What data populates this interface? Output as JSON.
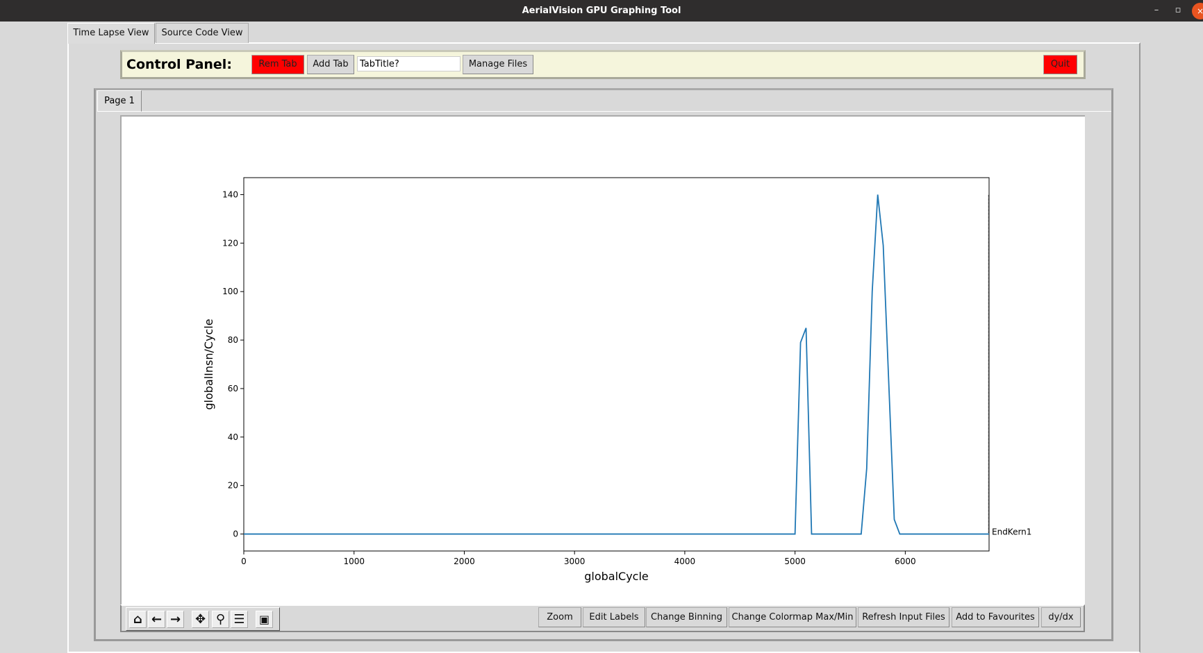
{
  "window": {
    "title": "AerialVision GPU Graphing Tool",
    "minimize": "–",
    "maximize": "▫",
    "close": "×"
  },
  "tabs": [
    {
      "label": "Time Lapse View",
      "active": true
    },
    {
      "label": "Source Code View",
      "active": false
    }
  ],
  "control_panel": {
    "title": "Control Panel:",
    "rem_tab": "Rem Tab",
    "add_tab": "Add Tab",
    "tab_title_value": "TabTitle?",
    "manage_files": "Manage Files",
    "quit": "Quit",
    "danger_color": "#ff0000"
  },
  "page_tabs": [
    {
      "label": "Page 1"
    }
  ],
  "toolbar": {
    "icons": [
      "home-icon",
      "back-arrow-icon",
      "forward-arrow-icon",
      "pan-icon",
      "zoom-magnifier-icon",
      "configure-subplots-icon",
      "save-icon"
    ],
    "buttons": [
      "Zoom",
      "Edit Labels",
      "Change Binning",
      "Change Colormap Max/Min",
      "Refresh Input Files",
      "Add to Favourites",
      "dy/dx"
    ]
  },
  "chart_data": {
    "type": "line",
    "xlabel": "globalCycle",
    "ylabel": "globalInsn/Cycle",
    "xlim": [
      0,
      6760
    ],
    "ylim": [
      -7,
      147
    ],
    "xticks": [
      0,
      1000,
      2000,
      3000,
      4000,
      5000,
      6000
    ],
    "yticks": [
      0,
      20,
      40,
      60,
      80,
      100,
      120,
      140
    ],
    "series": [
      {
        "color": "#1f77b4",
        "x": [
          0,
          5000,
          5050,
          5100,
          5150,
          5600,
          5650,
          5700,
          5750,
          5800,
          5900,
          5950,
          6760
        ],
        "y": [
          0,
          0,
          79,
          85,
          0,
          0,
          27,
          100,
          140,
          119,
          6,
          0,
          0
        ]
      }
    ],
    "annotations": [
      {
        "label": "EndKern1",
        "x": 6755,
        "style": "dotted-vertical-line"
      }
    ],
    "grid": false
  }
}
